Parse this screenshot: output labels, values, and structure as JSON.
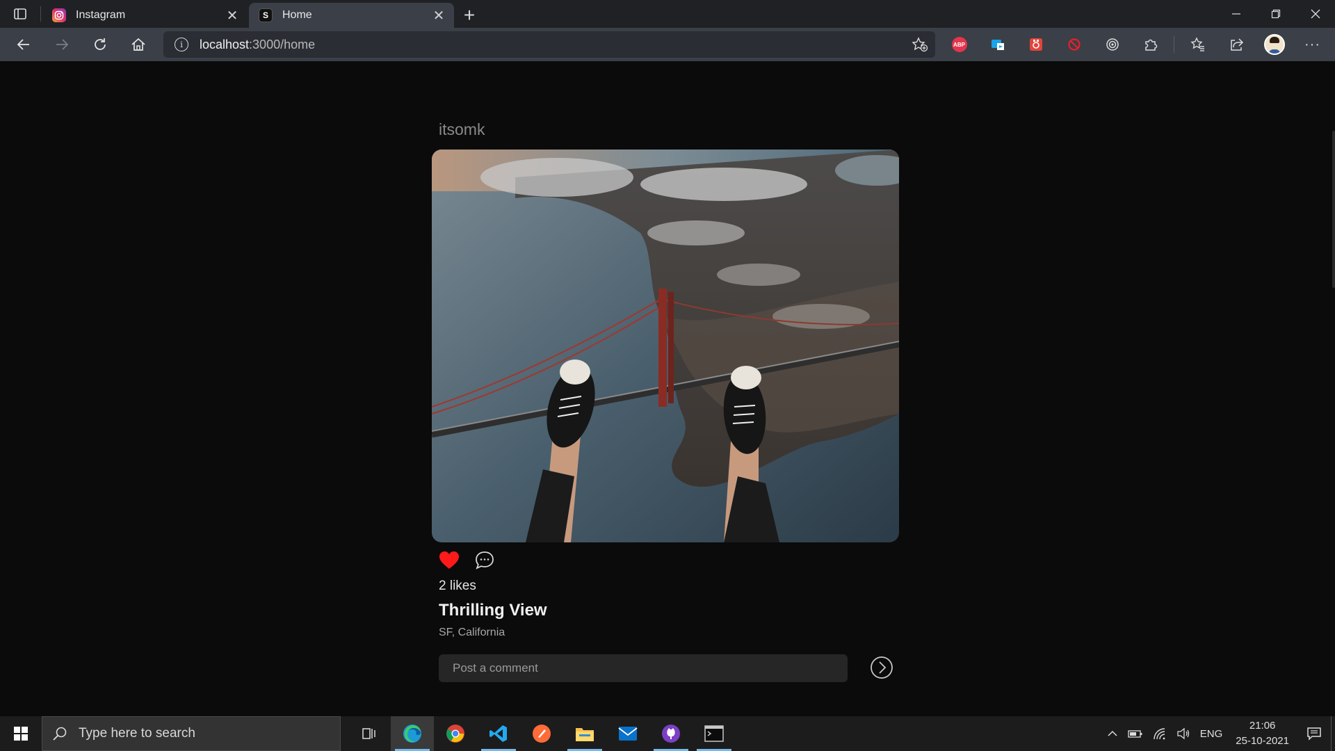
{
  "browser": {
    "tabs": [
      {
        "label": "Instagram",
        "favicon": "instagram-logo"
      },
      {
        "label": "Home",
        "favicon": "S",
        "active": true
      }
    ],
    "url": {
      "host": "localhost",
      "path": ":3000/home"
    }
  },
  "post": {
    "username": "itsomk",
    "image_alt": "Aerial view of feet dangling above the Golden Gate Bridge",
    "likes_text": "2 likes",
    "liked": true,
    "title": "Thrilling View",
    "location": "SF, California",
    "comment_placeholder": "Post a comment"
  },
  "taskbar": {
    "search_placeholder": "Type here to search",
    "language": "ENG",
    "time": "21:06",
    "date": "25-10-2021"
  },
  "colors": {
    "heart": "#ff1a1a",
    "page_bg": "#0b0b0b",
    "toolbar_bg": "#3b3f47"
  }
}
